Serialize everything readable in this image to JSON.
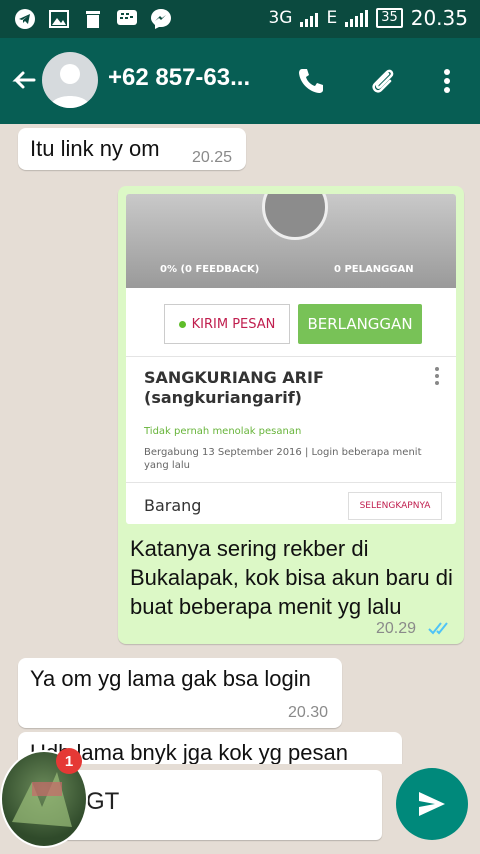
{
  "statusbar": {
    "icons": [
      "telegram-icon",
      "image-icon",
      "trash-icon",
      "bbm-icon",
      "messenger-icon"
    ],
    "network_3g": "3G",
    "network_e": "E",
    "battery": "35",
    "time": "20.35"
  },
  "appbar": {
    "contact": "+62 857-63...",
    "icons": [
      "back-arrow-icon",
      "call-icon",
      "attach-icon",
      "menu-icon"
    ]
  },
  "messages": {
    "m1": {
      "text": "Itu link ny om",
      "time": "20.25"
    },
    "m2": {
      "card": {
        "feedback": "0% (0 FEEDBACK)",
        "pelanggan": "0 PELANGGAN",
        "kirim_pesan": "KIRIM PESAN",
        "berlangganan": "BERLANGGAN",
        "name": "SANGKURIANG ARIF",
        "handle": "(sangkuriangarif)",
        "status": "Tidak pernah menolak pesanan",
        "joined": "Bergabung 13 September 2016  |  Login beberapa menit yang lalu",
        "barang": "Barang",
        "selengkapnya": "SELENGKAPNYA"
      },
      "caption": "Katanya sering rekber di Bukalapak, kok bisa akun baru di buat beberapa menit yg lalu",
      "time": "20.29",
      "read_color": "#4fc3f7"
    },
    "m3": {
      "text": "Ya om yg lama gak bsa login",
      "time": "20.30"
    },
    "m4": {
      "text": "Udh lama bnyk jga kok yg pesan"
    }
  },
  "input": {
    "value": "GT"
  },
  "chathead": {
    "badge": "1"
  },
  "colors": {
    "header": "#075e54",
    "statusbar": "#0b4a3f",
    "outgoing": "#dcf8c6",
    "send": "#00897b"
  }
}
